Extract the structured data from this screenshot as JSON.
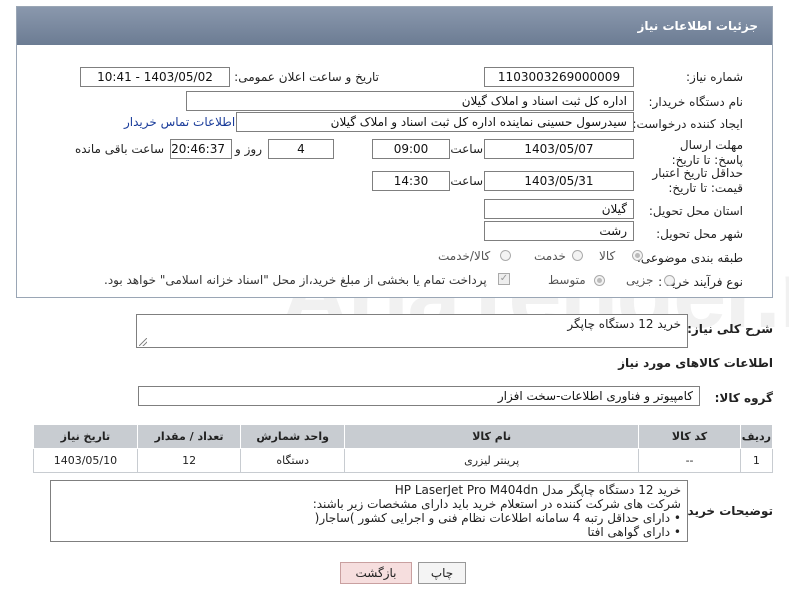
{
  "header": {
    "title": "جزئیات اطلاعات نیاز"
  },
  "fields": {
    "need_number_label": "شماره نیاز:",
    "need_number": "1103003269000009",
    "announce_label": "تاریخ و ساعت اعلان عمومی:",
    "announce_value": "1403/05/02 - 10:41",
    "buyer_org_label": "نام دستگاه خریدار:",
    "buyer_org": "اداره کل ثبت اسناد و املاک گیلان",
    "creator_label": "ایجاد کننده درخواست:",
    "creator": "سیدرسول حسینی نماینده اداره کل ثبت اسناد و املاک گیلان",
    "contact_link": "اطلاعات تماس خریدار",
    "deadline_label": "مهلت ارسال پاسخ: تا تاریخ:",
    "deadline_date": "1403/05/07",
    "time_label": "ساعت",
    "deadline_time": "09:00",
    "days_value": "4",
    "days_label": "روز و",
    "remaining_time": "20:46:37",
    "remaining_label": "ساعت باقی مانده",
    "validity_label": "حداقل تاریخ اعتبار قیمت: تا تاریخ:",
    "validity_date": "1403/05/31",
    "validity_time": "14:30",
    "province_label": "استان محل تحویل:",
    "province": "گیلان",
    "city_label": "شهر محل تحویل:",
    "city": "رشت",
    "category_label": "طبقه بندی موضوعی:",
    "category_options": [
      "کالا",
      "خدمت",
      "کالا/خدمت"
    ],
    "purchase_type_label": "نوع فرآیند خرید :",
    "purchase_options": [
      "جزیی",
      "متوسط"
    ],
    "payment_note": "پرداخت تمام یا بخشی از مبلغ خرید،از محل \"اسناد خزانه اسلامی\" خواهد بود."
  },
  "summary": {
    "label": "شرح کلی نیاز:",
    "value": "خرید 12 دستگاه چاپگر"
  },
  "goods_section": {
    "title": "اطلاعات کالاهای مورد نیاز",
    "group_label": "گروه کالا:",
    "group_value": "کامپیوتر و فناوری اطلاعات-سخت افزار"
  },
  "table": {
    "headers": [
      "ردیف",
      "کد کالا",
      "نام کالا",
      "واحد شمارش",
      "تعداد / مقدار",
      "تاریخ نیاز"
    ],
    "rows": [
      [
        "1",
        "--",
        "پرینتر لیزری",
        "دستگاه",
        "12",
        "1403/05/10"
      ]
    ]
  },
  "buyer_notes": {
    "label": "توضیحات خریدار:",
    "lines": [
      "خرید 12 دستگاه چاپگر  مدل HP LaserJet Pro M404dn",
      "شرکت های شرکت کننده در استعلام خرید باید دارای مشخصات زیر باشند:",
      "• دارای حداقل رتبه 4 سامانه اطلاعات نظام فنی و اجرایی کشور )ساجار(",
      "• دارای گواهی افتا"
    ]
  },
  "buttons": {
    "print": "چاپ",
    "back": "بازگشت"
  },
  "watermark": "AriaTender.net",
  "colors": {
    "header_bg": "#7a8aa1",
    "table_header_bg": "#c8ccd1",
    "back_button_bg": "#f6dede"
  }
}
